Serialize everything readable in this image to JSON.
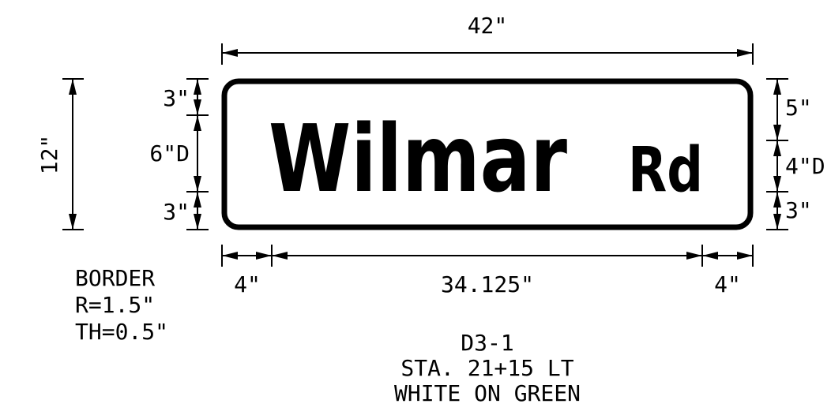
{
  "sign": {
    "main_text": "Wilmar",
    "suffix_text": "Rd",
    "border_color": "#000000"
  },
  "dimensions": {
    "overall_width": "42\"",
    "overall_height": "12\"",
    "left_top_margin": "3\"",
    "left_letter_height": "6\"D",
    "left_bottom_margin": "3\"",
    "right_top_margin": "5\"",
    "right_letter_height": "4\"D",
    "right_bottom_margin": "3\"",
    "left_margin": "4\"",
    "text_width": "34.125\"",
    "right_margin": "4\""
  },
  "border_note": {
    "line1": "BORDER",
    "line2": "R=1.5\"",
    "line3": "TH=0.5\""
  },
  "sign_info": {
    "code": "D3-1",
    "station": "STA. 21+15 LT",
    "colors": "WHITE ON GREEN"
  }
}
